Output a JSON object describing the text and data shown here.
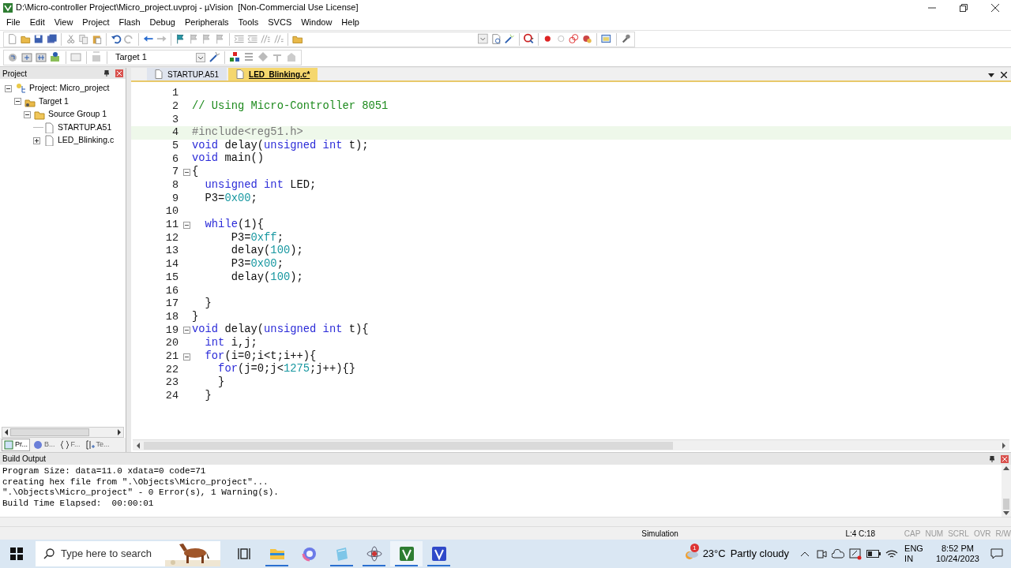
{
  "window": {
    "title": "D:\\Micro-controller Project\\Micro_project.uvproj - µVision  [Non-Commercial Use License]"
  },
  "menu": [
    "File",
    "Edit",
    "View",
    "Project",
    "Flash",
    "Debug",
    "Peripherals",
    "Tools",
    "SVCS",
    "Window",
    "Help"
  ],
  "build_toolbar": {
    "target": "Target 1"
  },
  "project_pane": {
    "title": "Project",
    "tree": [
      {
        "label": "Project: Micro_project",
        "kind": "project",
        "expander": true,
        "expanded": true,
        "children": [
          {
            "label": "Target 1",
            "kind": "target",
            "expander": true,
            "expanded": true,
            "children": [
              {
                "label": "Source Group 1",
                "kind": "group",
                "expander": true,
                "expanded": true,
                "children": [
                  {
                    "label": "STARTUP.A51",
                    "kind": "file",
                    "expander": false,
                    "expanded": false
                  },
                  {
                    "label": "LED_Blinking.c",
                    "kind": "file",
                    "expander": true,
                    "expanded": false
                  }
                ]
              }
            ]
          }
        ]
      }
    ],
    "tabs": [
      {
        "label": "Pr...",
        "kind": "project",
        "selected": true
      },
      {
        "label": "B...",
        "kind": "books",
        "selected": false
      },
      {
        "label": "F...",
        "kind": "functions",
        "selected": false
      },
      {
        "label": "Te...",
        "kind": "templates",
        "selected": false
      }
    ]
  },
  "editor": {
    "tabs": [
      {
        "label": "STARTUP.A51",
        "selected": false
      },
      {
        "label": "LED_Blinking.c*",
        "selected": true
      }
    ],
    "lines": [
      {
        "n": "1",
        "fold": false,
        "current": false
      },
      {
        "n": "2",
        "fold": false,
        "current": false,
        "tokens": [
          {
            "kind": "comment",
            "text": "// Using Micro-Controller 8051"
          }
        ]
      },
      {
        "n": "3",
        "fold": false,
        "current": false
      },
      {
        "n": "4",
        "fold": false,
        "current": true,
        "tokens": [
          {
            "kind": "preproc",
            "text": "#include<reg51.h>"
          }
        ]
      },
      {
        "n": "5",
        "fold": false,
        "current": false,
        "tokens": [
          {
            "kind": "keyword",
            "text": "void"
          },
          {
            "kind": "plain",
            "text": " delay("
          },
          {
            "kind": "keyword",
            "text": "unsigned int"
          },
          {
            "kind": "plain",
            "text": " t);"
          }
        ]
      },
      {
        "n": "6",
        "fold": false,
        "current": false,
        "tokens": [
          {
            "kind": "keyword",
            "text": "void"
          },
          {
            "kind": "plain",
            "text": " main()"
          }
        ]
      },
      {
        "n": "7",
        "fold": true,
        "current": false,
        "tokens": [
          {
            "kind": "plain",
            "text": "{"
          }
        ]
      },
      {
        "n": "8",
        "fold": false,
        "current": false,
        "tokens": [
          {
            "kind": "keyword",
            "text": "  unsigned int"
          },
          {
            "kind": "plain",
            "text": " LED;"
          }
        ]
      },
      {
        "n": "9",
        "fold": false,
        "current": false,
        "tokens": [
          {
            "kind": "plain",
            "text": "  P3="
          },
          {
            "kind": "number",
            "text": "0x00"
          },
          {
            "kind": "plain",
            "text": ";"
          }
        ]
      },
      {
        "n": "10",
        "fold": false,
        "current": false
      },
      {
        "n": "11",
        "fold": true,
        "current": false,
        "tokens": [
          {
            "kind": "keyword",
            "text": "  while"
          },
          {
            "kind": "plain",
            "text": "(1){"
          }
        ]
      },
      {
        "n": "12",
        "fold": false,
        "current": false,
        "tokens": [
          {
            "kind": "plain",
            "text": "      P3="
          },
          {
            "kind": "number",
            "text": "0xff"
          },
          {
            "kind": "plain",
            "text": ";"
          }
        ]
      },
      {
        "n": "13",
        "fold": false,
        "current": false,
        "tokens": [
          {
            "kind": "plain",
            "text": "      delay("
          },
          {
            "kind": "number",
            "text": "100"
          },
          {
            "kind": "plain",
            "text": ");"
          }
        ]
      },
      {
        "n": "14",
        "fold": false,
        "current": false,
        "tokens": [
          {
            "kind": "plain",
            "text": "      P3="
          },
          {
            "kind": "number",
            "text": "0x00"
          },
          {
            "kind": "plain",
            "text": ";"
          }
        ]
      },
      {
        "n": "15",
        "fold": false,
        "current": false,
        "tokens": [
          {
            "kind": "plain",
            "text": "      delay("
          },
          {
            "kind": "number",
            "text": "100"
          },
          {
            "kind": "plain",
            "text": ");"
          }
        ]
      },
      {
        "n": "16",
        "fold": false,
        "current": false
      },
      {
        "n": "17",
        "fold": false,
        "current": false,
        "tokens": [
          {
            "kind": "plain",
            "text": "  }"
          }
        ]
      },
      {
        "n": "18",
        "fold": false,
        "current": false,
        "tokens": [
          {
            "kind": "plain",
            "text": "}"
          }
        ]
      },
      {
        "n": "19",
        "fold": true,
        "current": false,
        "tokens": [
          {
            "kind": "keyword",
            "text": "void"
          },
          {
            "kind": "plain",
            "text": " delay("
          },
          {
            "kind": "keyword",
            "text": "unsigned int"
          },
          {
            "kind": "plain",
            "text": " t){"
          }
        ]
      },
      {
        "n": "20",
        "fold": false,
        "current": false,
        "tokens": [
          {
            "kind": "keyword",
            "text": "  int"
          },
          {
            "kind": "plain",
            "text": " i,j;"
          }
        ]
      },
      {
        "n": "21",
        "fold": true,
        "current": false,
        "tokens": [
          {
            "kind": "keyword",
            "text": "  for"
          },
          {
            "kind": "plain",
            "text": "(i=0;i<t;i++){"
          }
        ]
      },
      {
        "n": "22",
        "fold": false,
        "current": false,
        "tokens": [
          {
            "kind": "keyword",
            "text": "    for"
          },
          {
            "kind": "plain",
            "text": "(j=0;j<"
          },
          {
            "kind": "number",
            "text": "1275"
          },
          {
            "kind": "plain",
            "text": ";j++){}"
          }
        ]
      },
      {
        "n": "23",
        "fold": false,
        "current": false,
        "tokens": [
          {
            "kind": "plain",
            "text": "    }"
          }
        ]
      },
      {
        "n": "24",
        "fold": false,
        "current": false,
        "tokens": [
          {
            "kind": "plain",
            "text": "  }"
          }
        ]
      }
    ]
  },
  "build_output": {
    "title": "Build Output",
    "lines": [
      "Program Size: data=11.0 xdata=0 code=71",
      "creating hex file from \".\\Objects\\Micro_project\"...",
      "\".\\Objects\\Micro_project\" - 0 Error(s), 1 Warning(s).",
      "Build Time Elapsed:  00:00:01"
    ]
  },
  "status_bar": {
    "mode": "Simulation",
    "position": "L:4 C:18",
    "indicators": [
      {
        "label": "CAP",
        "on": false
      },
      {
        "label": "NUM",
        "on": false
      },
      {
        "label": "SCRL",
        "on": false
      },
      {
        "label": "OVR",
        "on": false
      },
      {
        "label": "R/W",
        "on": false
      }
    ]
  },
  "taskbar": {
    "search": {
      "placeholder": "Type here to search"
    },
    "apps": [
      {
        "kind": "taskview",
        "running": false,
        "selected": false
      },
      {
        "kind": "explorer",
        "running": true,
        "selected": false
      },
      {
        "kind": "copilot",
        "running": false,
        "selected": false
      },
      {
        "kind": "notepad",
        "running": true,
        "selected": false
      },
      {
        "kind": "bug",
        "running": true,
        "selected": false
      },
      {
        "kind": "uv5",
        "running": true,
        "selected": true
      },
      {
        "kind": "uv4",
        "running": true,
        "selected": false
      }
    ],
    "weather": {
      "temperature": "23°C",
      "condition": "Partly cloudy",
      "badge": "1"
    },
    "language": {
      "code": "ENG",
      "region": "IN"
    },
    "clock": {
      "time": "8:52 PM",
      "date": "10/24/2023"
    }
  }
}
